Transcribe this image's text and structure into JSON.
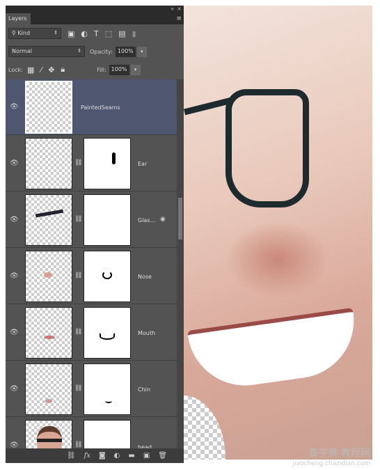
{
  "panel": {
    "tab": "Layers",
    "filter": "Kind",
    "blend_mode": "Normal",
    "opacity_label": "Opacity:",
    "opacity": "100%",
    "lock_label": "Lock:",
    "fill_label": "Fill:",
    "fill": "100%"
  },
  "layers": [
    {
      "name": "PaintedSeams",
      "selected": true,
      "has_mask": false
    },
    {
      "name": "Ear",
      "has_mask": true
    },
    {
      "name": "Glas...",
      "has_mask": true
    },
    {
      "name": "Nose",
      "has_mask": true
    },
    {
      "name": "Mouth",
      "has_mask": true
    },
    {
      "name": "Chin",
      "has_mask": true
    },
    {
      "name": "head",
      "has_mask": true
    }
  ],
  "footer_icons": [
    "link-icon",
    "fx-icon",
    "mask-icon",
    "adjustment-icon",
    "folder-icon",
    "new-layer-icon",
    "trash-icon"
  ],
  "watermark": {
    "line1": "查字典 教程网",
    "line2": "jiaocheng.chazidian.com"
  },
  "colors": {
    "panel": "#535353",
    "selected": "#4e5670"
  }
}
